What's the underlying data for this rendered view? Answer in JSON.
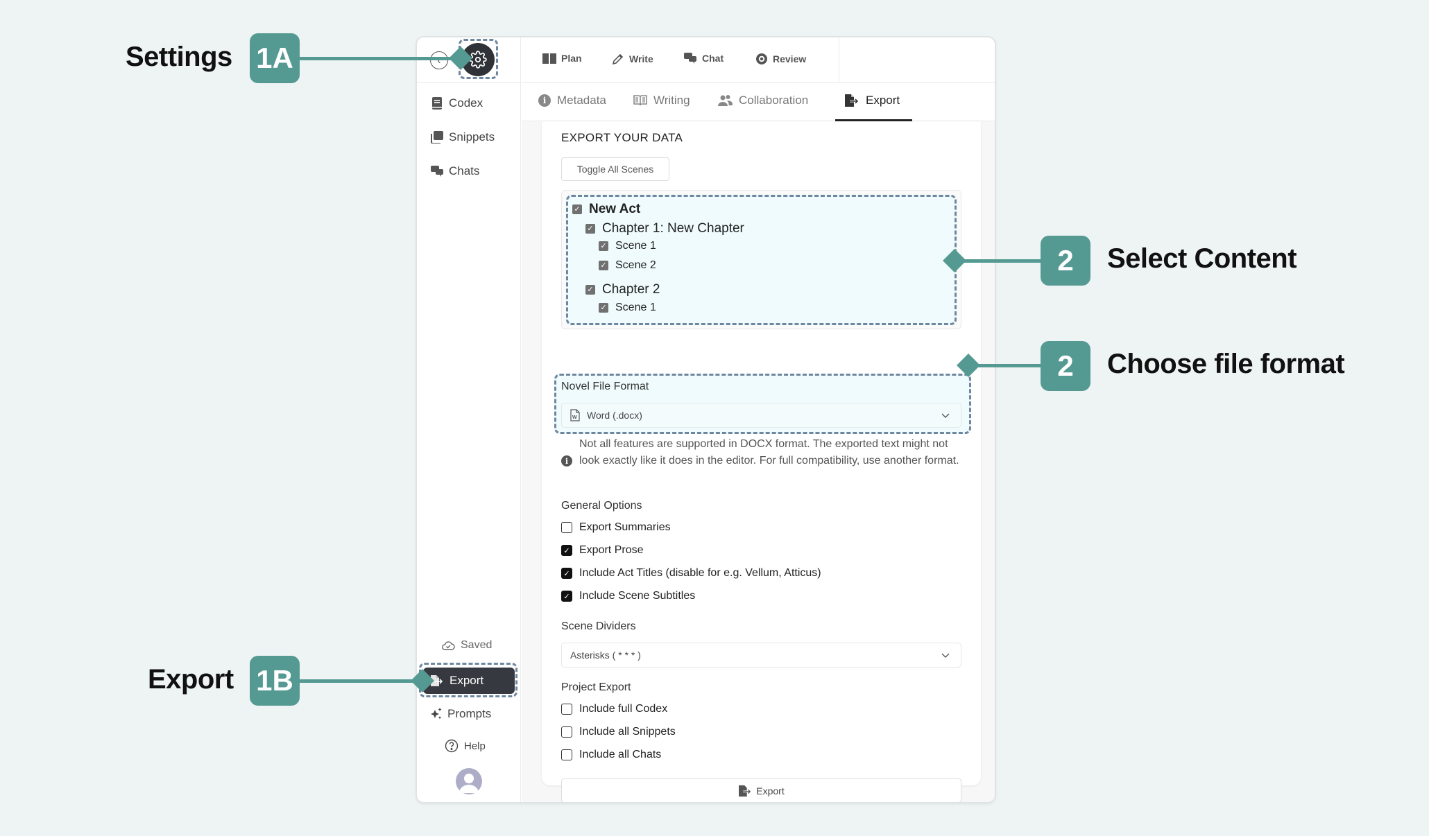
{
  "annotations": {
    "settings": {
      "label": "Settings",
      "badge": "1A"
    },
    "export": {
      "label": "Export",
      "badge": "1B"
    },
    "select_content": {
      "label": "Select Content",
      "badge": "2"
    },
    "choose_format": {
      "label": "Choose file format",
      "badge": "2"
    },
    "accent_color": "#559a92",
    "highlight_border_color": "#6f879e"
  },
  "header": {
    "back_icon": "chevron-left-circle-icon",
    "settings_icon": "gear-icon",
    "nav": [
      {
        "label": "Plan",
        "icon": "book-open-icon"
      },
      {
        "label": "Write",
        "icon": "pencil-icon"
      },
      {
        "label": "Chat",
        "icon": "chat-bubbles-icon"
      },
      {
        "label": "Review",
        "icon": "eye-icon"
      }
    ]
  },
  "sidebar": {
    "items": [
      {
        "label": "Codex",
        "icon": "book-icon"
      },
      {
        "label": "Snippets",
        "icon": "snippets-icon"
      },
      {
        "label": "Chats",
        "icon": "chat-bubbles-icon"
      }
    ],
    "saved_label": "Saved",
    "export_label": "Export",
    "prompts_label": "Prompts",
    "help_label": "Help"
  },
  "tabs": [
    {
      "label": "Metadata",
      "icon": "info-icon",
      "active": false
    },
    {
      "label": "Writing",
      "icon": "book-open-icon",
      "active": false
    },
    {
      "label": "Collaboration",
      "icon": "users-icon",
      "active": false
    },
    {
      "label": "Export",
      "icon": "file-export-icon",
      "active": true
    }
  ],
  "export_panel": {
    "title": "EXPORT YOUR DATA",
    "toggle_all_label": "Toggle All Scenes",
    "tree": [
      {
        "label": "New Act",
        "level": 0,
        "checked": true
      },
      {
        "label": "Chapter 1: New Chapter",
        "level": 1,
        "checked": true
      },
      {
        "label": "Scene 1",
        "level": 2,
        "checked": true
      },
      {
        "label": "Scene 2",
        "level": 2,
        "checked": true
      },
      {
        "label": "Chapter 2",
        "level": 1,
        "checked": true
      },
      {
        "label": "Scene 1",
        "level": 2,
        "checked": true
      }
    ],
    "format_label": "Novel File Format",
    "format_value": "Word (.docx)",
    "format_note": "Not all features are supported in DOCX format. The exported text might not look exactly like it does in the editor. For full compatibility, use another format.",
    "general_options_label": "General Options",
    "general_options": [
      {
        "label": "Export Summaries",
        "checked": false
      },
      {
        "label": "Export Prose",
        "checked": true
      },
      {
        "label": "Include Act Titles (disable for e.g. Vellum, Atticus)",
        "checked": true
      },
      {
        "label": "Include Scene Subtitles",
        "checked": true
      }
    ],
    "scene_dividers_label": "Scene Dividers",
    "scene_dividers_value": "Asterisks ( * * * )",
    "project_export_label": "Project Export",
    "project_options": [
      {
        "label": "Include full Codex",
        "checked": false
      },
      {
        "label": "Include all Snippets",
        "checked": false
      },
      {
        "label": "Include all Chats",
        "checked": false
      }
    ],
    "export_button_label": "Export"
  }
}
